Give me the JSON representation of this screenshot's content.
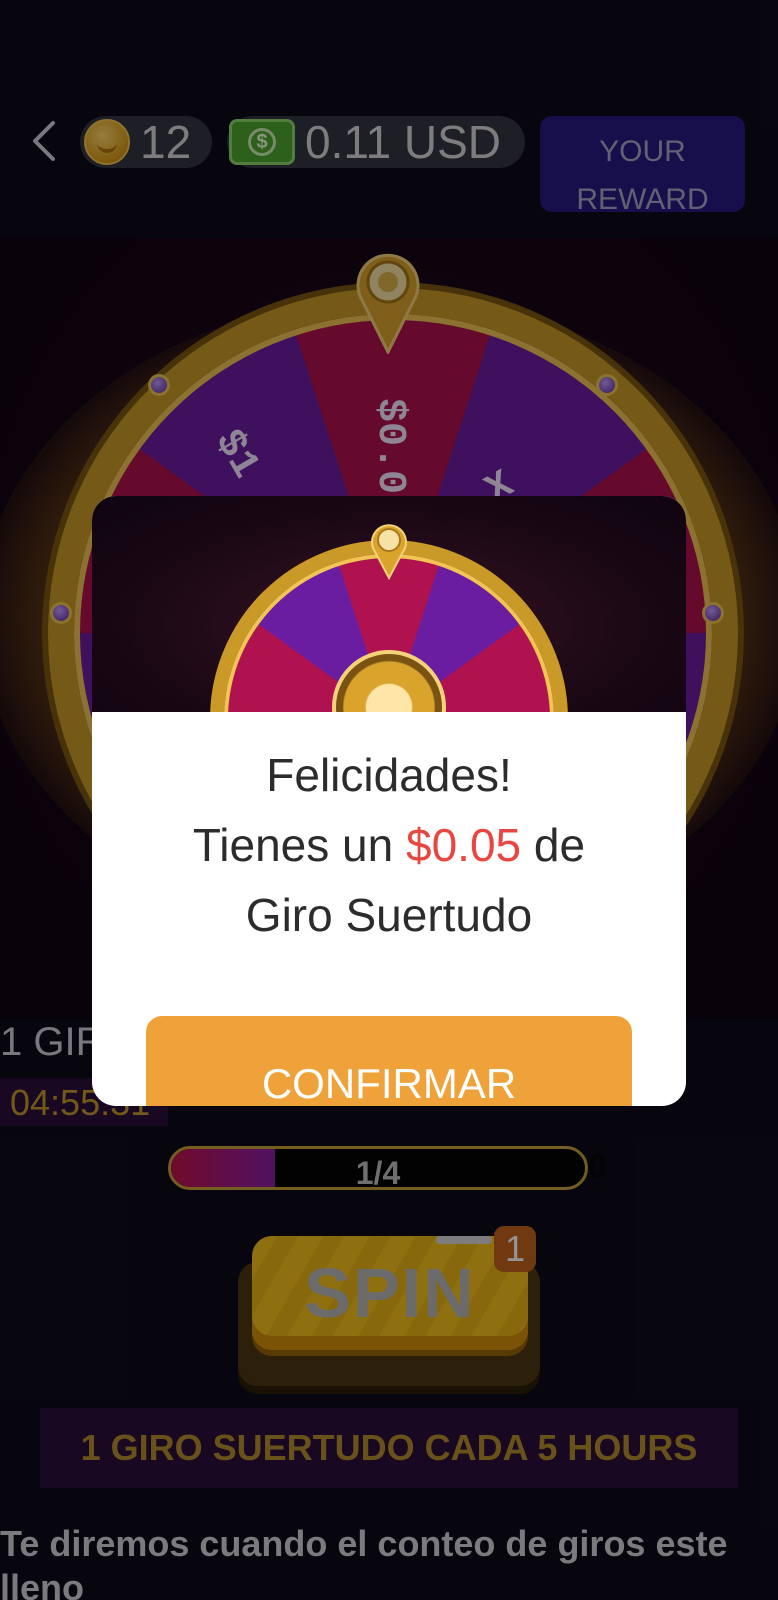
{
  "header": {
    "coins": "12",
    "balance": "0.11 USD",
    "reward_button": "YOUR REWARD",
    "cash_symbol": "$"
  },
  "wheel": {
    "labels": [
      "$0.0",
      "$1",
      "X"
    ]
  },
  "status": {
    "giros_label": "1 GIR",
    "timer": "04:55:31"
  },
  "progress": {
    "text": "1/4",
    "value": 0.25,
    "end_label": "0"
  },
  "spin": {
    "label": "SPIN",
    "badge": "1"
  },
  "banner": "1 GIRO SUERTUDO CADA 5 HOURS",
  "info": "Te diremos cuando el conteo de giros este lleno",
  "modal": {
    "line1": "Felicidades!",
    "line2_prefix": "Tienes un ",
    "amount": "$0.05",
    "line2_suffix": " de",
    "line3": "Giro Suertudo",
    "confirm": "CONFIRMAR"
  },
  "colors": {
    "accent_orange": "#f0a23a",
    "amount_red": "#e8473f",
    "reward_blue": "#271b82",
    "banner_purple": "#2b0e3c"
  },
  "icons": [
    "back-chevron-icon",
    "crown-coin-icon",
    "cash-icon"
  ]
}
